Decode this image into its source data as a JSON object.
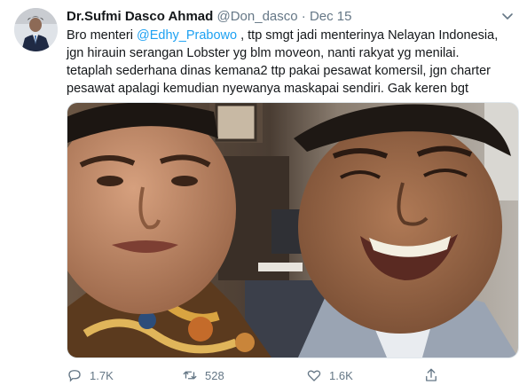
{
  "tweet": {
    "author_name": "Dr.Sufmi Dasco Ahmad",
    "handle": "@Don_dasco",
    "separator": "·",
    "date": "Dec 15",
    "text_before_mention": "Bro menteri ",
    "mention": "@Edhy_Prabowo",
    "text_after_mention": " , ttp smgt jadi menterinya Nelayan Indonesia,",
    "text_line2": "jgn hirauin serangan Lobster yg blm moveon, nanti rakyat yg menilai.",
    "text_line3": "tetaplah sederhana dinas kemana2 ttp pakai pesawat komersil, jgn charter",
    "text_line4": "pesawat apalagi kemudian nyewanya maskapai sendiri. Gak keren bgt"
  },
  "actions": {
    "reply_count": "1.7K",
    "retweet_count": "528",
    "like_count": "1.6K"
  },
  "icons": {
    "more": "chevron-down-icon",
    "reply": "reply-icon",
    "retweet": "retweet-icon",
    "like": "heart-icon",
    "share": "share-icon"
  },
  "colors": {
    "accent": "#1da1f2",
    "muted": "#657786",
    "text": "#14171a"
  }
}
